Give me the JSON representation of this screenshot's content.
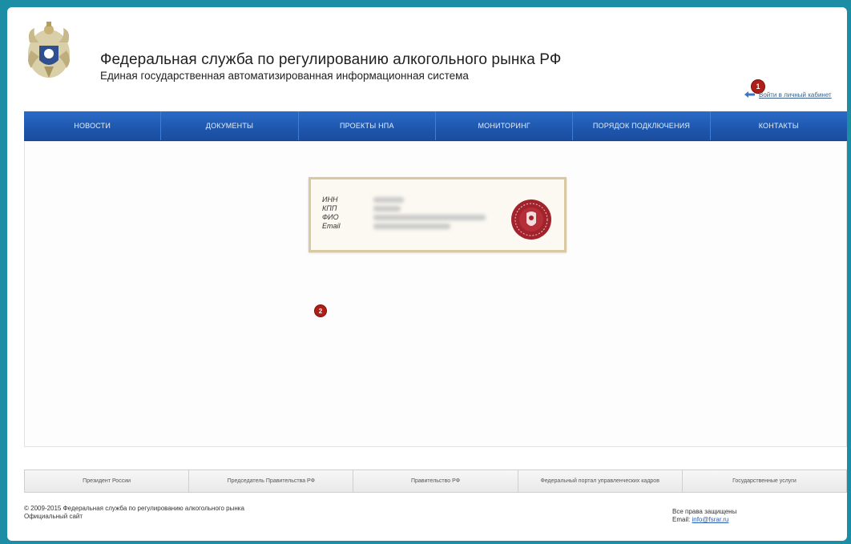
{
  "header": {
    "title": "Федеральная служба по регулированию алкогольного рынка РФ",
    "subtitle": "Единая государственная автоматизированная информационная система",
    "login_link": "Войти в личный кабинет",
    "badge_login": "1"
  },
  "nav": {
    "items": [
      {
        "label": "Новости"
      },
      {
        "label": "Документы"
      },
      {
        "label": "Проекты НПА"
      },
      {
        "label": "Мониторинг"
      },
      {
        "label": "Порядок подключения"
      },
      {
        "label": "Контакты"
      }
    ]
  },
  "certificate": {
    "badge": "2",
    "labels": [
      "ИНН",
      "КПП",
      "ФИО",
      "Email"
    ]
  },
  "footer": {
    "links": [
      {
        "label": "Президент России"
      },
      {
        "label": "Председатель Правительства РФ"
      },
      {
        "label": "Правительство РФ"
      },
      {
        "label": "Федеральный портал управленческих кадров"
      },
      {
        "label": "Государственные услуги"
      }
    ],
    "copyright_line1": "© 2009-2015 Федеральная служба по регулированию алкогольного рынка",
    "copyright_line2": "Официальный сайт",
    "rights_text": "Все права защищены",
    "email_label": "Email:",
    "email": "info@fsrar.ru"
  },
  "colors": {
    "frame": "#1b8ea6",
    "nav": "#1e56ad",
    "badge": "#b01e17",
    "seal": "#a3232d",
    "card_border": "#d8c9a3"
  }
}
